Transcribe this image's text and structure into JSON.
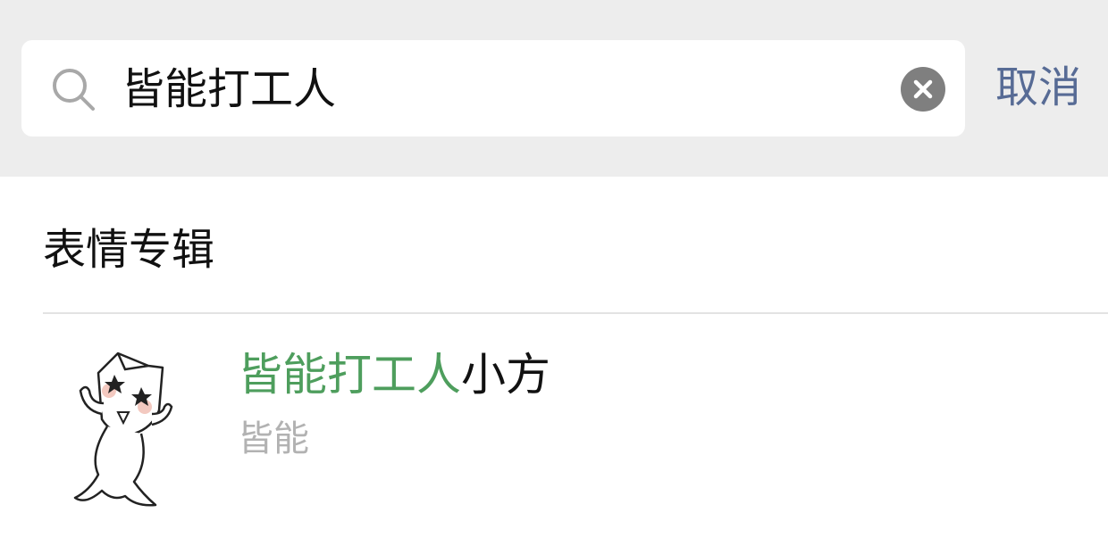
{
  "search": {
    "query": "皆能打工人",
    "cancel_label": "取消"
  },
  "section": {
    "title": "表情专辑"
  },
  "results": [
    {
      "title_highlight": "皆能打工人",
      "title_rest": "小方",
      "author": "皆能",
      "highlight_color": "#4e9e5d"
    }
  ],
  "colors": {
    "accent_link": "#576b95",
    "highlight": "#4e9e5d",
    "top_bar_bg": "#ededed"
  },
  "icons": {
    "search": "search-icon",
    "clear": "clear-icon",
    "sticker": "cat-sticker-thumbnail"
  }
}
